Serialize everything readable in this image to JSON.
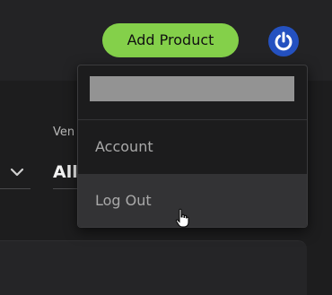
{
  "header": {
    "add_product_label": "Add Product",
    "power_icon": "power-icon",
    "accent_color": "#84d04a",
    "avatar_color": "#2451c0"
  },
  "filters": {
    "vendor_label": "Ven",
    "vendor_value": "All",
    "chevron_icon": "chevron-down-icon"
  },
  "user_menu": {
    "items": [
      {
        "label": "Account"
      },
      {
        "label": "Log Out"
      }
    ],
    "hovered_item": "Log Out"
  }
}
